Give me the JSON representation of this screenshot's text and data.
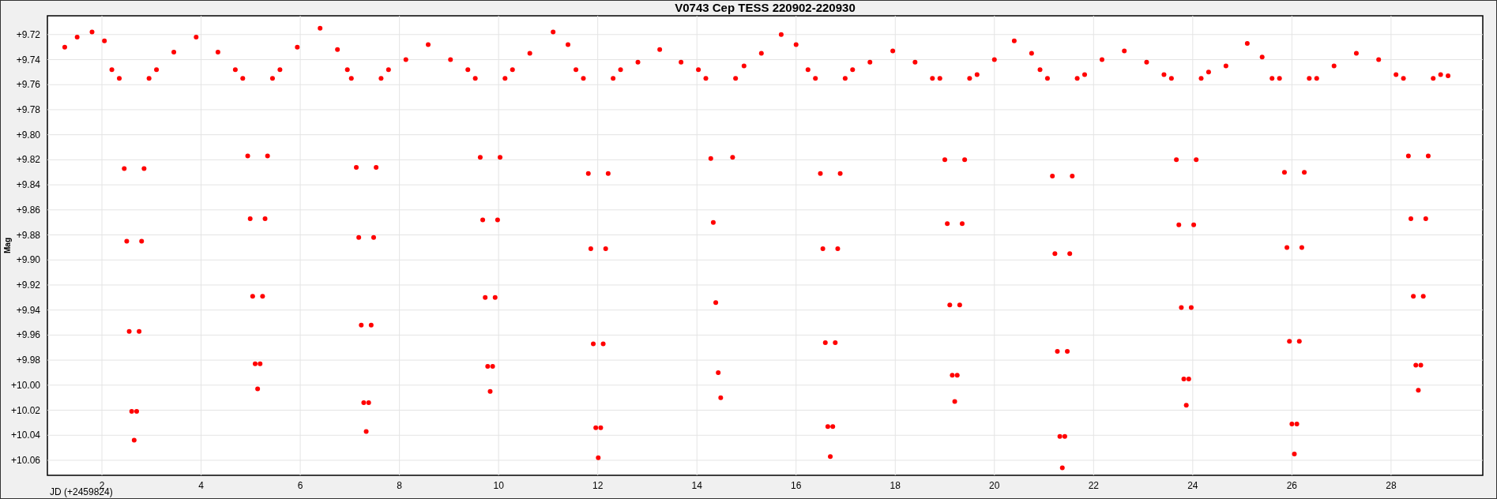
{
  "chart_data": {
    "type": "scatter",
    "title": "V0743 Cep TESS 220902-220930",
    "xlabel": "JD (+2459824)",
    "ylabel": "Mag",
    "grid": true,
    "xlim": [
      0.9,
      29.85
    ],
    "ylim": [
      10.072,
      9.705
    ],
    "xticks": [
      2,
      4,
      6,
      8,
      10,
      12,
      14,
      16,
      18,
      20,
      22,
      24,
      26,
      28
    ],
    "yticks": [
      {
        "value": 9.72,
        "label": "+9.72"
      },
      {
        "value": 9.74,
        "label": "+9.74"
      },
      {
        "value": 9.76,
        "label": "+9.76"
      },
      {
        "value": 9.78,
        "label": "+9.78"
      },
      {
        "value": 9.8,
        "label": "+9.80"
      },
      {
        "value": 9.82,
        "label": "+9.82"
      },
      {
        "value": 9.84,
        "label": "+9.84"
      },
      {
        "value": 9.86,
        "label": "+9.86"
      },
      {
        "value": 9.88,
        "label": "+9.88"
      },
      {
        "value": 9.9,
        "label": "+9.90"
      },
      {
        "value": 9.92,
        "label": "+9.92"
      },
      {
        "value": 9.94,
        "label": "+9.94"
      },
      {
        "value": 9.96,
        "label": "+9.96"
      },
      {
        "value": 9.98,
        "label": "+9.98"
      },
      {
        "value": 10.0,
        "label": "+10.00"
      },
      {
        "value": 10.02,
        "label": "+10.02"
      },
      {
        "value": 10.04,
        "label": "+10.04"
      },
      {
        "value": 10.06,
        "label": "+10.06"
      }
    ],
    "x": [
      1.25,
      1.5,
      1.8,
      2.05,
      2.2,
      2.35,
      2.45,
      2.5,
      2.55,
      2.6,
      2.65,
      2.7,
      2.75,
      2.8,
      2.85,
      2.95,
      3.1,
      3.45,
      3.9,
      4.34,
      4.69,
      4.84,
      4.94,
      4.99,
      5.04,
      5.09,
      5.14,
      5.19,
      5.24,
      5.29,
      5.34,
      5.44,
      5.59,
      5.94,
      6.4,
      6.75,
      6.95,
      7.03,
      7.13,
      7.18,
      7.23,
      7.28,
      7.33,
      7.38,
      7.43,
      7.48,
      7.53,
      7.63,
      7.78,
      8.13,
      8.58,
      9.03,
      9.38,
      9.53,
      9.63,
      9.68,
      9.73,
      9.78,
      9.83,
      9.88,
      9.93,
      9.98,
      10.03,
      10.13,
      10.28,
      10.63,
      11.1,
      11.4,
      11.56,
      11.71,
      11.81,
      11.86,
      11.91,
      11.96,
      12.01,
      12.06,
      12.11,
      12.16,
      12.21,
      12.31,
      12.46,
      12.81,
      13.25,
      13.68,
      14.03,
      14.18,
      14.28,
      14.33,
      14.38,
      14.43,
      14.48,
      14.72,
      14.78,
      14.95,
      15.3,
      15.7,
      16.0,
      16.24,
      16.39,
      16.49,
      16.54,
      16.59,
      16.64,
      16.69,
      16.74,
      16.79,
      16.84,
      16.89,
      16.99,
      17.14,
      17.49,
      17.95,
      18.4,
      18.75,
      18.9,
      19.0,
      19.05,
      19.1,
      19.15,
      19.2,
      19.25,
      19.3,
      19.35,
      19.4,
      19.5,
      19.65,
      20.0,
      20.4,
      20.75,
      20.92,
      21.07,
      21.17,
      21.22,
      21.27,
      21.32,
      21.37,
      21.42,
      21.47,
      21.52,
      21.57,
      21.67,
      21.82,
      22.17,
      22.62,
      23.07,
      23.42,
      23.57,
      23.67,
      23.72,
      23.77,
      23.82,
      23.87,
      23.92,
      23.97,
      24.02,
      24.07,
      24.17,
      24.32,
      24.67,
      25.1,
      25.4,
      25.6,
      25.75,
      25.85,
      25.9,
      25.95,
      26.0,
      26.05,
      26.1,
      26.15,
      26.2,
      26.25,
      26.35,
      26.5,
      26.85,
      27.3,
      27.75,
      28.1,
      28.25,
      28.35,
      28.4,
      28.45,
      28.5,
      28.55,
      28.6,
      28.65,
      28.7,
      28.75,
      28.85,
      29.0,
      29.15
    ],
    "series": [
      {
        "color": "#ff0000",
        "values": [
          9.73,
          9.722,
          9.718,
          9.725,
          9.748,
          9.755,
          9.827,
          9.885,
          9.957,
          10.021,
          10.044,
          10.021,
          9.957,
          9.885,
          9.827,
          9.755,
          9.748,
          9.734,
          9.722,
          9.734,
          9.748,
          9.755,
          9.817,
          9.867,
          9.929,
          9.983,
          10.003,
          9.983,
          9.929,
          9.867,
          9.817,
          9.755,
          9.748,
          9.73,
          9.715,
          9.732,
          9.748,
          9.755,
          9.826,
          9.882,
          9.952,
          10.014,
          10.037,
          10.014,
          9.952,
          9.882,
          9.826,
          9.755,
          9.748,
          9.74,
          9.728,
          9.74,
          9.748,
          9.755,
          9.818,
          9.868,
          9.93,
          9.985,
          10.005,
          9.985,
          9.93,
          9.868,
          9.818,
          9.755,
          9.748,
          9.735,
          9.718,
          9.728,
          9.748,
          9.755,
          9.831,
          9.891,
          9.967,
          10.034,
          10.058,
          10.034,
          9.967,
          9.891,
          9.831,
          9.755,
          9.748,
          9.742,
          9.732,
          9.742,
          9.748,
          9.755,
          9.819,
          9.87,
          9.934,
          9.99,
          10.01,
          9.818,
          9.755,
          9.745,
          9.735,
          9.72,
          9.728,
          9.748,
          9.755,
          9.831,
          9.891,
          9.966,
          10.033,
          10.057,
          10.033,
          9.966,
          9.891,
          9.831,
          9.755,
          9.748,
          9.742,
          9.733,
          9.742,
          9.755,
          9.755,
          9.82,
          9.871,
          9.936,
          9.992,
          10.013,
          9.992,
          9.936,
          9.871,
          9.82,
          9.755,
          9.752,
          9.74,
          9.725,
          9.735,
          9.748,
          9.755,
          9.833,
          9.895,
          9.973,
          10.041,
          10.066,
          10.041,
          9.973,
          9.895,
          9.833,
          9.755,
          9.752,
          9.74,
          9.733,
          9.742,
          9.752,
          9.755,
          9.82,
          9.872,
          9.938,
          9.995,
          10.016,
          9.995,
          9.938,
          9.872,
          9.82,
          9.755,
          9.75,
          9.745,
          9.727,
          9.738,
          9.755,
          9.755,
          9.83,
          9.89,
          9.965,
          10.031,
          10.055,
          10.031,
          9.965,
          9.89,
          9.83,
          9.755,
          9.755,
          9.745,
          9.735,
          9.74,
          9.752,
          9.755,
          9.817,
          9.867,
          9.929,
          9.984,
          10.004,
          9.984,
          9.929,
          9.867,
          9.817,
          9.755,
          9.752,
          9.753
        ]
      }
    ]
  }
}
